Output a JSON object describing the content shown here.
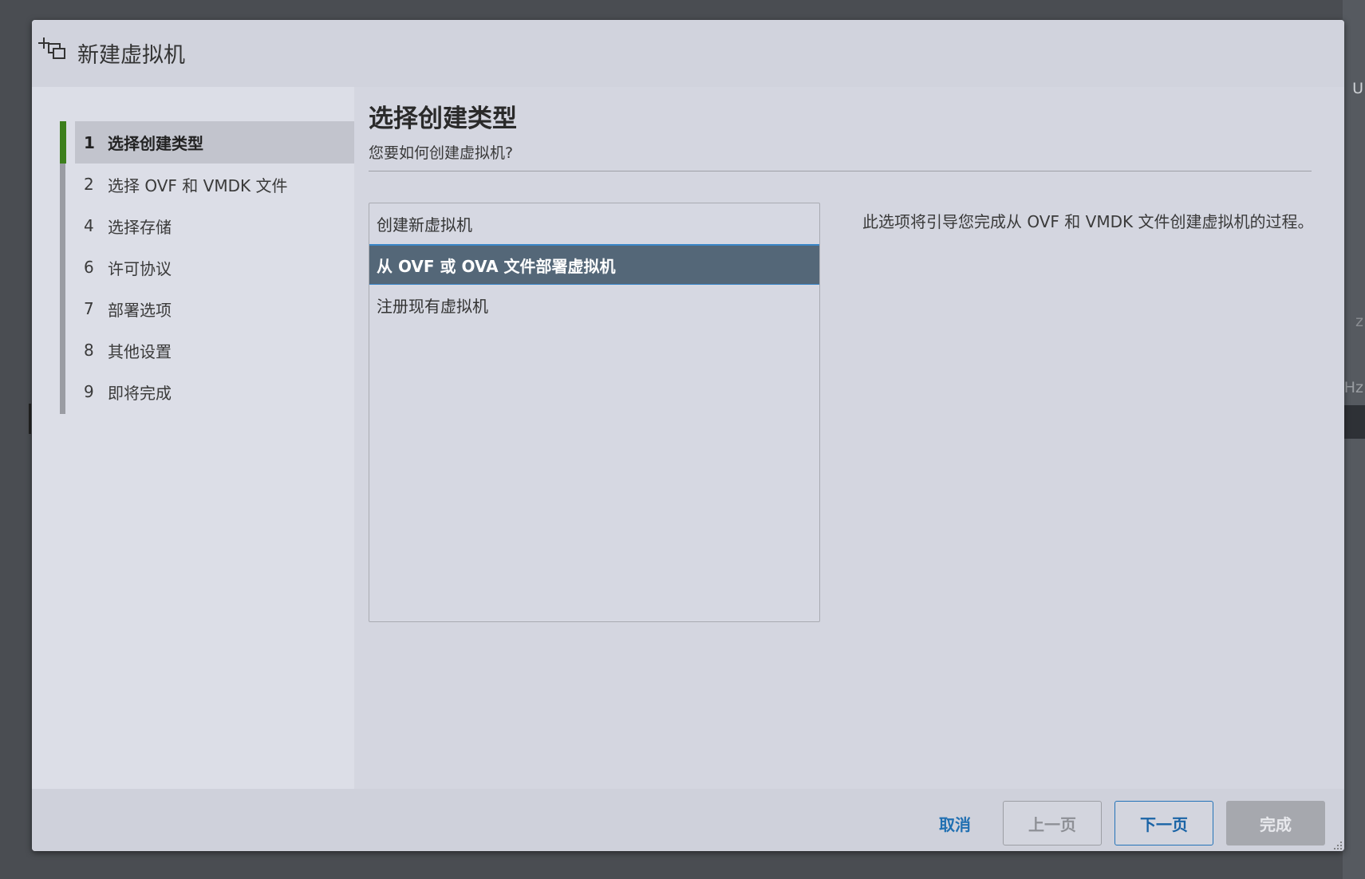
{
  "dialog": {
    "title": "新建虚拟机",
    "icon": "new-vm-icon"
  },
  "steps": [
    {
      "num": "1",
      "label": "选择创建类型",
      "active": true
    },
    {
      "num": "2",
      "label": "选择 OVF 和 VMDK 文件",
      "active": false
    },
    {
      "num": "4",
      "label": "选择存储",
      "active": false
    },
    {
      "num": "6",
      "label": "许可协议",
      "active": false
    },
    {
      "num": "7",
      "label": "部署选项",
      "active": false
    },
    {
      "num": "8",
      "label": "其他设置",
      "active": false
    },
    {
      "num": "9",
      "label": "即将完成",
      "active": false
    }
  ],
  "main": {
    "title": "选择创建类型",
    "subtitle": "您要如何创建虚拟机?",
    "options": [
      {
        "label": "创建新虚拟机",
        "selected": false
      },
      {
        "label": "从 OVF 或 OVA 文件部署虚拟机",
        "selected": true
      },
      {
        "label": "注册现有虚拟机",
        "selected": false
      }
    ],
    "description": "此选项将引导您完成从 OVF 和 VMDK 文件创建虚拟机的过程。"
  },
  "footer": {
    "cancel": "取消",
    "prev": "上一页",
    "next": "下一页",
    "finish": "完成"
  },
  "background": {
    "edge_texts": [
      "U",
      "z",
      "Hz"
    ]
  },
  "colors": {
    "active_step_marker": "#3c7f1c",
    "selected_option_bg": "#546778",
    "link_blue": "#2170b2"
  }
}
